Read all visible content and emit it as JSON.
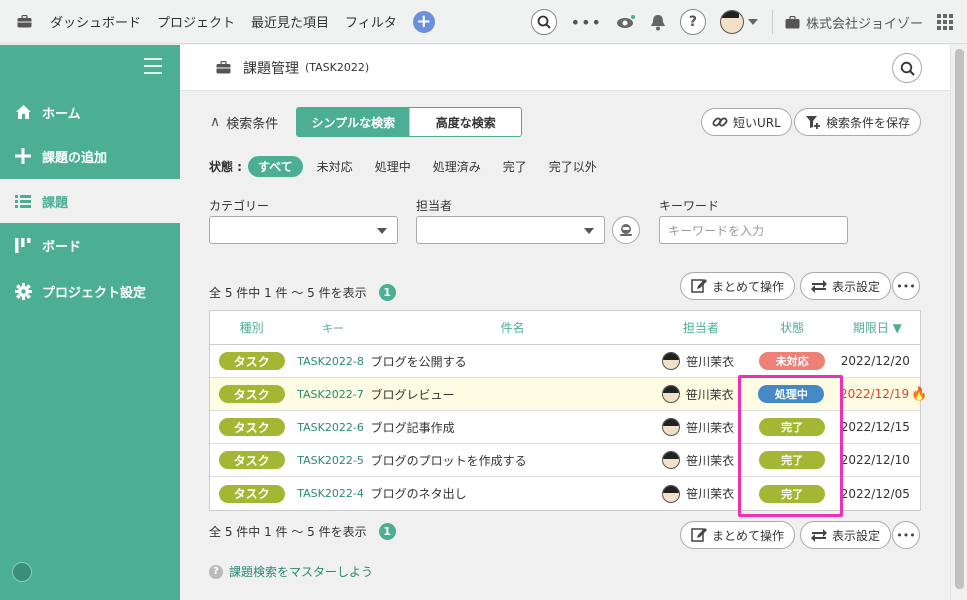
{
  "topbar": {
    "nav": [
      "ダッシュボード",
      "プロジェクト",
      "最近見た項目",
      "フィルタ"
    ],
    "company": "株式会社ジョイゾー"
  },
  "sidebar": {
    "items": [
      {
        "label": "ホーム",
        "icon": "home-icon"
      },
      {
        "label": "課題の追加",
        "icon": "plus-icon"
      },
      {
        "label": "課題",
        "icon": "list-icon"
      },
      {
        "label": "ボード",
        "icon": "board-icon"
      },
      {
        "label": "プロジェクト設定",
        "icon": "gear-icon"
      }
    ],
    "active_index": 2
  },
  "header": {
    "title": "課題管理",
    "key": "(TASK2022)"
  },
  "search": {
    "title": "検索条件",
    "simple": "シンプルな検索",
    "advanced": "高度な検索",
    "short_url": "短いURL",
    "save": "検索条件を保存",
    "status_label": "状態 :",
    "status_options": [
      "すべて",
      "未対応",
      "処理中",
      "処理済み",
      "完了",
      "完了以外"
    ],
    "category_label": "カテゴリー",
    "assignee_label": "担当者",
    "keyword_label": "キーワード",
    "keyword_placeholder": "キーワードを入力"
  },
  "results": {
    "count_text": "全 5 件中 1 件 ～ 5 件を表示",
    "page": "1",
    "bulk": "まとめて操作",
    "display": "表示設定"
  },
  "table": {
    "headers": {
      "type": "種別",
      "key": "キー",
      "name": "件名",
      "person": "担当者",
      "status": "状態",
      "due": "期限日 ▼"
    },
    "rows": [
      {
        "type": "タスク",
        "key": "TASK2022-8",
        "name": "ブログを公開する",
        "person": "笹川茉衣",
        "status": "未対応",
        "status_color": "#ed8077",
        "due": "2022/12/20",
        "due_color": "#333333",
        "overdue": false,
        "highlight": false
      },
      {
        "type": "タスク",
        "key": "TASK2022-7",
        "name": "ブログレビュー",
        "person": "笹川茉衣",
        "status": "処理中",
        "status_color": "#4488c5",
        "due": "2022/12/19",
        "due_color": "#e0442b",
        "overdue": true,
        "highlight": true
      },
      {
        "type": "タスク",
        "key": "TASK2022-6",
        "name": "ブログ記事作成",
        "person": "笹川茉衣",
        "status": "完了",
        "status_color": "#a3b735",
        "due": "2022/12/15",
        "due_color": "#333333",
        "overdue": false,
        "highlight": false
      },
      {
        "type": "タスク",
        "key": "TASK2022-5",
        "name": "ブログのプロットを作成する",
        "person": "笹川茉衣",
        "status": "完了",
        "status_color": "#a3b735",
        "due": "2022/12/10",
        "due_color": "#333333",
        "overdue": false,
        "highlight": false
      },
      {
        "type": "タスク",
        "key": "TASK2022-4",
        "name": "ブログのネタ出し",
        "person": "笹川茉衣",
        "status": "完了",
        "status_color": "#a3b735",
        "due": "2022/12/05",
        "due_color": "#333333",
        "overdue": false,
        "highlight": false
      }
    ]
  },
  "help": {
    "link": "課題検索をマスターしよう",
    "icon": "?"
  },
  "colors": {
    "brand": "#4caf94",
    "highlight_box": "#ee31b2"
  }
}
